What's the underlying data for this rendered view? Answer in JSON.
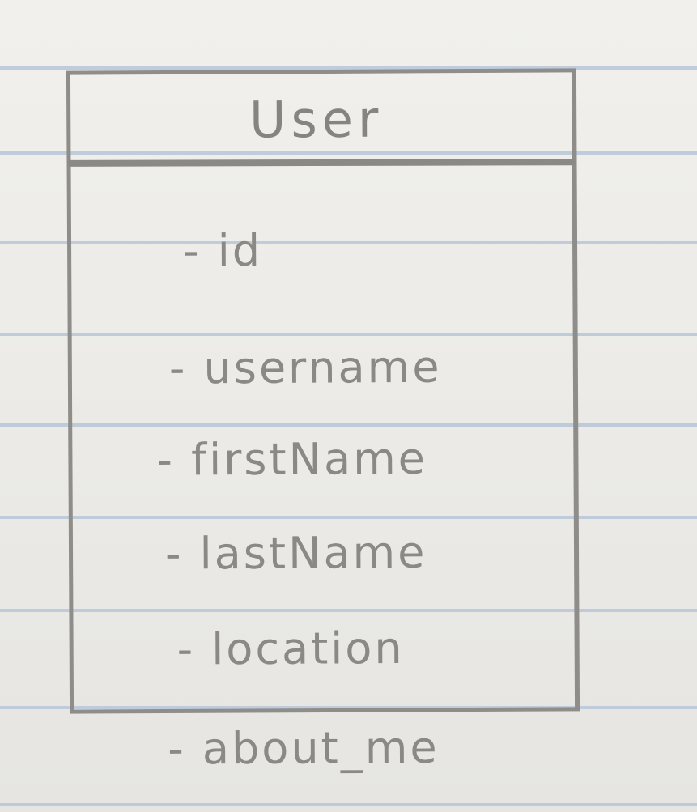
{
  "diagram": {
    "class_name": "User",
    "attributes": [
      "- id",
      "- username",
      "- firstName",
      "- lastName",
      "- location",
      "- about_me"
    ]
  },
  "colors": {
    "paper": "#ecebe7",
    "ruled_line": "#b6c6d8",
    "pencil": "#8a8986"
  }
}
